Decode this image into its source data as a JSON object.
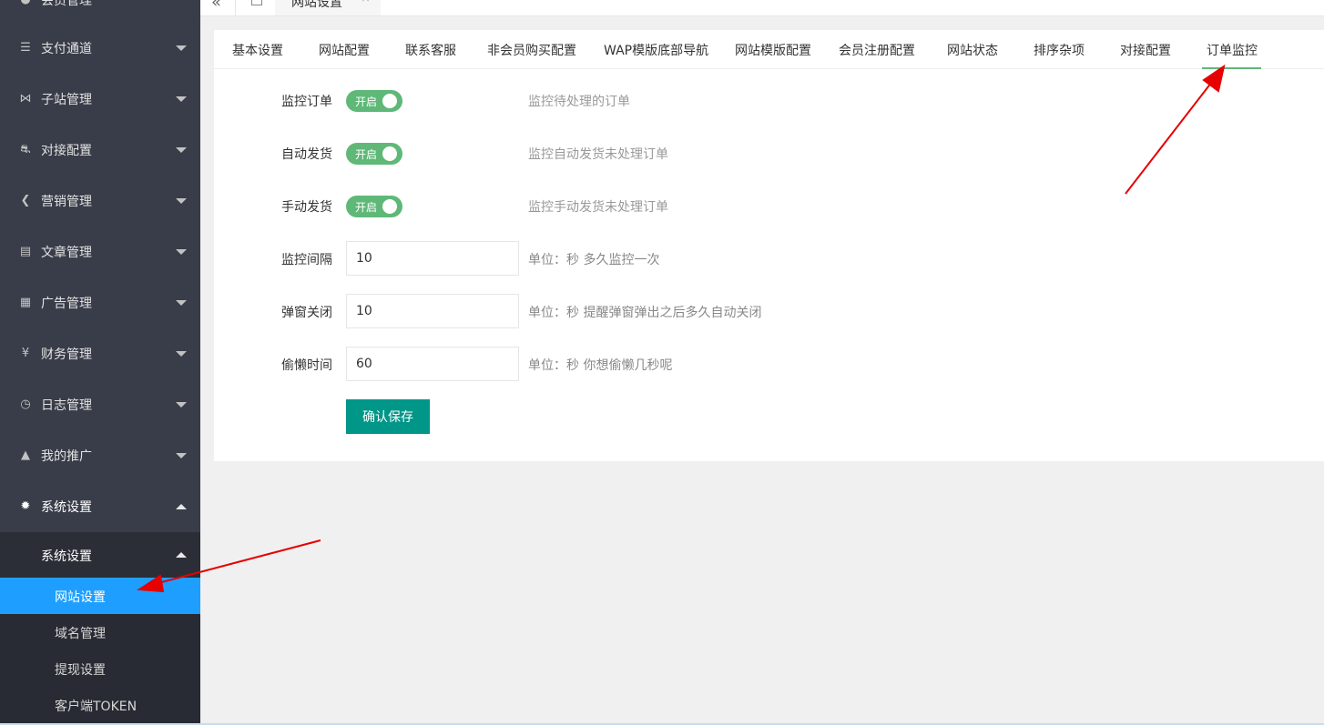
{
  "sidebar": {
    "top_item": "会员管理",
    "items": [
      {
        "label": "支付通道",
        "icon": "list-icon"
      },
      {
        "label": "子站管理",
        "icon": "sitemap-icon"
      },
      {
        "label": "对接配置",
        "icon": "link-icon"
      },
      {
        "label": "营销管理",
        "icon": "share-icon"
      },
      {
        "label": "文章管理",
        "icon": "document-icon"
      },
      {
        "label": "广告管理",
        "icon": "calendar-icon"
      },
      {
        "label": "财务管理",
        "icon": "yen-icon"
      },
      {
        "label": "日志管理",
        "icon": "clock-icon"
      },
      {
        "label": "我的推广",
        "icon": "tree-icon"
      },
      {
        "label": "系统设置",
        "icon": "gear-icon"
      }
    ],
    "sub_header": "系统设置",
    "sub_items": [
      "网站设置",
      "域名管理",
      "提现设置",
      "客户端TOKEN"
    ],
    "active_sub": "网站设置"
  },
  "topbar": {
    "page_tab": "网站设置"
  },
  "tabs": [
    "基本设置",
    "网站配置",
    "联系客服",
    "非会员购买配置",
    "WAP模版底部导航",
    "网站模版配置",
    "会员注册配置",
    "网站状态",
    "排序杂项",
    "对接配置",
    "订单监控"
  ],
  "active_tab": "订单监控",
  "form": {
    "monitor_order": {
      "label": "监控订单",
      "toggle": "开启",
      "hint": "监控待处理的订单"
    },
    "auto_ship": {
      "label": "自动发货",
      "toggle": "开启",
      "hint": "监控自动发货未处理订单"
    },
    "manual_ship": {
      "label": "手动发货",
      "toggle": "开启",
      "hint": "监控手动发货未处理订单"
    },
    "interval": {
      "label": "监控间隔",
      "value": "10",
      "hint": "单位：秒 多久监控一次"
    },
    "popup_close": {
      "label": "弹窗关闭",
      "value": "10",
      "hint": "单位：秒 提醒弹窗弹出之后多久自动关闭"
    },
    "idle_time": {
      "label": "偷懒时间",
      "value": "60",
      "hint": "单位：秒 你想偷懒几秒呢"
    },
    "save_label": "确认保存"
  },
  "colors": {
    "sidebar_bg": "#393d49",
    "active_blue": "#1e9fff",
    "toggle_green": "#5fb878",
    "save_teal": "#009688",
    "annotation_red": "#e60000"
  }
}
